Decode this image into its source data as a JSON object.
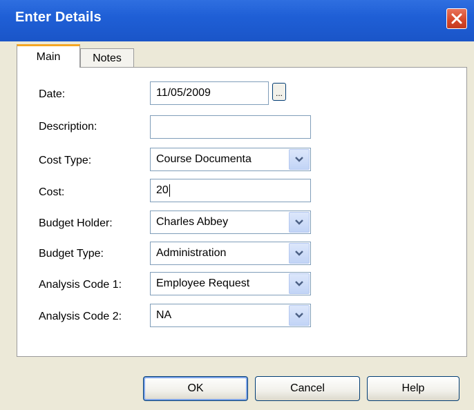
{
  "window": {
    "title": "Enter Details",
    "close_symbol": "✕"
  },
  "tabs": [
    {
      "label": "Main",
      "active": true
    },
    {
      "label": "Notes",
      "active": false
    }
  ],
  "form": {
    "date": {
      "label": "Date:",
      "value": "11/05/2009",
      "picker_label": "..."
    },
    "description": {
      "label": "Description:",
      "value": ""
    },
    "cost_type": {
      "label": "Cost Type:",
      "value": "Course Documenta"
    },
    "cost": {
      "label": "Cost:",
      "value": "20"
    },
    "budget_holder": {
      "label": "Budget Holder:",
      "value": "Charles Abbey"
    },
    "budget_type": {
      "label": "Budget Type:",
      "value": "Administration"
    },
    "analysis_code_1": {
      "label": "Analysis Code 1:",
      "value": "Employee Request"
    },
    "analysis_code_2": {
      "label": "Analysis Code 2:",
      "value": "NA"
    }
  },
  "buttons": {
    "ok": "OK",
    "cancel": "Cancel",
    "help": "Help"
  },
  "colors": {
    "titlebar": "#1f5fd6",
    "dialog_bg": "#ece9d8",
    "active_tab_accent": "#f5a623",
    "close_button": "#d74a2b"
  },
  "icons": {
    "close": "close-icon",
    "dropdown": "chevron-down-icon"
  }
}
